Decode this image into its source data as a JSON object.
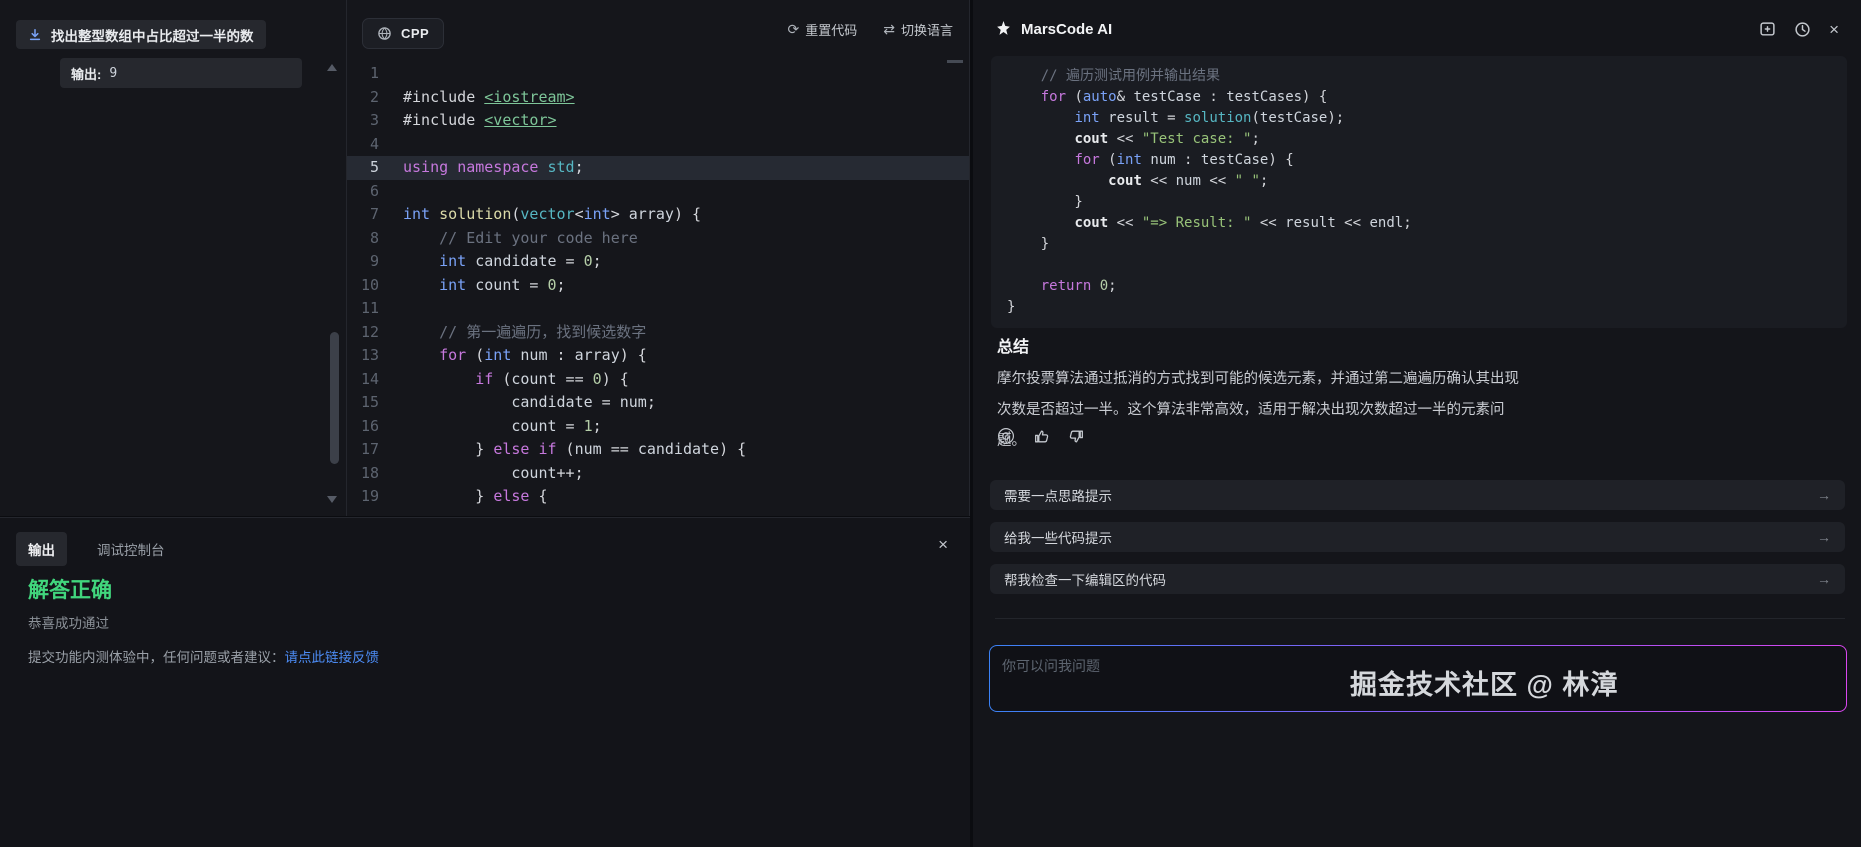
{
  "problem": {
    "title": "找出整型数组中占比超过一半的数",
    "sample": {
      "label": "输出:",
      "value": "9"
    }
  },
  "editor": {
    "language_label": "CPP",
    "actions": {
      "reset": "重置代码",
      "switch": "切换语言"
    },
    "highlight_line": 5,
    "lines": [
      {
        "n": 1,
        "tokens": []
      },
      {
        "n": 2,
        "tokens": [
          {
            "t": "#include ",
            "c": "pl"
          },
          {
            "t": "<iostream>",
            "c": "inc"
          }
        ]
      },
      {
        "n": 3,
        "tokens": [
          {
            "t": "#include ",
            "c": "pl"
          },
          {
            "t": "<vector>",
            "c": "inc"
          }
        ]
      },
      {
        "n": 4,
        "tokens": []
      },
      {
        "n": 5,
        "tokens": [
          {
            "t": "using",
            "c": "kw"
          },
          {
            "t": " ",
            "c": "pl"
          },
          {
            "t": "namespace",
            "c": "kw"
          },
          {
            "t": " ",
            "c": "pl"
          },
          {
            "t": "std",
            "c": "cls"
          },
          {
            "t": ";",
            "c": "pl"
          }
        ]
      },
      {
        "n": 6,
        "tokens": []
      },
      {
        "n": 7,
        "tokens": [
          {
            "t": "int",
            "c": "type"
          },
          {
            "t": " ",
            "c": "pl"
          },
          {
            "t": "solution",
            "c": "fn"
          },
          {
            "t": "(",
            "c": "pl"
          },
          {
            "t": "vector",
            "c": "cls"
          },
          {
            "t": "<",
            "c": "pl"
          },
          {
            "t": "int",
            "c": "type"
          },
          {
            "t": "> ",
            "c": "pl"
          },
          {
            "t": "array",
            "c": "var"
          },
          {
            "t": ") {",
            "c": "pl"
          }
        ]
      },
      {
        "n": 8,
        "tokens": [
          {
            "t": "    // Edit your code here",
            "c": "cm"
          }
        ]
      },
      {
        "n": 9,
        "tokens": [
          {
            "t": "    ",
            "c": "pl"
          },
          {
            "t": "int",
            "c": "type"
          },
          {
            "t": " ",
            "c": "pl"
          },
          {
            "t": "candidate",
            "c": "var"
          },
          {
            "t": " = ",
            "c": "pl"
          },
          {
            "t": "0",
            "c": "num"
          },
          {
            "t": ";",
            "c": "pl"
          }
        ]
      },
      {
        "n": 10,
        "tokens": [
          {
            "t": "    ",
            "c": "pl"
          },
          {
            "t": "int",
            "c": "type"
          },
          {
            "t": " ",
            "c": "pl"
          },
          {
            "t": "count",
            "c": "var"
          },
          {
            "t": " = ",
            "c": "pl"
          },
          {
            "t": "0",
            "c": "num"
          },
          {
            "t": ";",
            "c": "pl"
          }
        ]
      },
      {
        "n": 11,
        "tokens": []
      },
      {
        "n": 12,
        "tokens": [
          {
            "t": "    // 第一遍遍历，找到候选数字",
            "c": "cm"
          }
        ]
      },
      {
        "n": 13,
        "tokens": [
          {
            "t": "    ",
            "c": "pl"
          },
          {
            "t": "for",
            "c": "kw"
          },
          {
            "t": " (",
            "c": "pl"
          },
          {
            "t": "int",
            "c": "type"
          },
          {
            "t": " ",
            "c": "pl"
          },
          {
            "t": "num",
            "c": "var"
          },
          {
            "t": " : ",
            "c": "pl"
          },
          {
            "t": "array",
            "c": "var"
          },
          {
            "t": ") {",
            "c": "pl"
          }
        ]
      },
      {
        "n": 14,
        "tokens": [
          {
            "t": "        ",
            "c": "pl"
          },
          {
            "t": "if",
            "c": "kw"
          },
          {
            "t": " (",
            "c": "pl"
          },
          {
            "t": "count",
            "c": "var"
          },
          {
            "t": " == ",
            "c": "pl"
          },
          {
            "t": "0",
            "c": "num"
          },
          {
            "t": ") {",
            "c": "pl"
          }
        ]
      },
      {
        "n": 15,
        "tokens": [
          {
            "t": "            ",
            "c": "pl"
          },
          {
            "t": "candidate",
            "c": "var"
          },
          {
            "t": " = ",
            "c": "pl"
          },
          {
            "t": "num",
            "c": "var"
          },
          {
            "t": ";",
            "c": "pl"
          }
        ]
      },
      {
        "n": 16,
        "tokens": [
          {
            "t": "            ",
            "c": "pl"
          },
          {
            "t": "count",
            "c": "var"
          },
          {
            "t": " = ",
            "c": "pl"
          },
          {
            "t": "1",
            "c": "num"
          },
          {
            "t": ";",
            "c": "pl"
          }
        ]
      },
      {
        "n": 17,
        "tokens": [
          {
            "t": "        } ",
            "c": "pl"
          },
          {
            "t": "else",
            "c": "kw"
          },
          {
            "t": " ",
            "c": "pl"
          },
          {
            "t": "if",
            "c": "kw"
          },
          {
            "t": " (",
            "c": "pl"
          },
          {
            "t": "num",
            "c": "var"
          },
          {
            "t": " == ",
            "c": "pl"
          },
          {
            "t": "candidate",
            "c": "var"
          },
          {
            "t": ") {",
            "c": "pl"
          }
        ]
      },
      {
        "n": 18,
        "tokens": [
          {
            "t": "            ",
            "c": "pl"
          },
          {
            "t": "count",
            "c": "var"
          },
          {
            "t": "++;",
            "c": "pl"
          }
        ]
      },
      {
        "n": 19,
        "tokens": [
          {
            "t": "        } ",
            "c": "pl"
          },
          {
            "t": "else",
            "c": "kw"
          },
          {
            "t": " {",
            "c": "pl"
          }
        ]
      }
    ]
  },
  "console": {
    "tabs": [
      "输出",
      "调试控制台"
    ],
    "active_tab": "输出",
    "close_label": "×",
    "result_title": "解答正确",
    "result_subtitle": "恭喜成功通过",
    "feedback_prefix": "提交功能内测体验中，任何问题或者建议：",
    "feedback_link": "请点此链接反馈"
  },
  "assistant": {
    "title": "MarsCode AI",
    "close_label": "×",
    "code_lines": [
      [
        {
          "t": "    // 遍历测试用例并输出结果",
          "c": "cm"
        }
      ],
      [
        {
          "t": "    ",
          "c": "pl"
        },
        {
          "t": "for",
          "c": "kw"
        },
        {
          "t": " (",
          "c": "pl"
        },
        {
          "t": "auto",
          "c": "type"
        },
        {
          "t": "& ",
          "c": "pl"
        },
        {
          "t": "testCase",
          "c": "var"
        },
        {
          "t": " : ",
          "c": "pl"
        },
        {
          "t": "testCases",
          "c": "var"
        },
        {
          "t": ") {",
          "c": "pl"
        }
      ],
      [
        {
          "t": "        ",
          "c": "pl"
        },
        {
          "t": "int",
          "c": "type"
        },
        {
          "t": " ",
          "c": "pl"
        },
        {
          "t": "result",
          "c": "var"
        },
        {
          "t": " = ",
          "c": "pl"
        },
        {
          "t": "solution",
          "c": "cls"
        },
        {
          "t": "(",
          "c": "pl"
        },
        {
          "t": "testCase",
          "c": "var"
        },
        {
          "t": ");",
          "c": "pl"
        }
      ],
      [
        {
          "t": "        ",
          "c": "pl"
        },
        {
          "t": "cout",
          "c": "io"
        },
        {
          "t": " << ",
          "c": "pl"
        },
        {
          "t": "\"Test case: \"",
          "c": "str"
        },
        {
          "t": ";",
          "c": "pl"
        }
      ],
      [
        {
          "t": "        ",
          "c": "pl"
        },
        {
          "t": "for",
          "c": "kw"
        },
        {
          "t": " (",
          "c": "pl"
        },
        {
          "t": "int",
          "c": "type"
        },
        {
          "t": " ",
          "c": "pl"
        },
        {
          "t": "num",
          "c": "var"
        },
        {
          "t": " : ",
          "c": "pl"
        },
        {
          "t": "testCase",
          "c": "var"
        },
        {
          "t": ") {",
          "c": "pl"
        }
      ],
      [
        {
          "t": "            ",
          "c": "pl"
        },
        {
          "t": "cout",
          "c": "io"
        },
        {
          "t": " << ",
          "c": "pl"
        },
        {
          "t": "num",
          "c": "var"
        },
        {
          "t": " << ",
          "c": "pl"
        },
        {
          "t": "\" \"",
          "c": "str"
        },
        {
          "t": ";",
          "c": "pl"
        }
      ],
      [
        {
          "t": "        }",
          "c": "pl"
        }
      ],
      [
        {
          "t": "        ",
          "c": "pl"
        },
        {
          "t": "cout",
          "c": "io"
        },
        {
          "t": " << ",
          "c": "pl"
        },
        {
          "t": "\"=> Result: \"",
          "c": "str"
        },
        {
          "t": " << ",
          "c": "pl"
        },
        {
          "t": "result",
          "c": "var"
        },
        {
          "t": " << ",
          "c": "pl"
        },
        {
          "t": "endl",
          "c": "var"
        },
        {
          "t": ";",
          "c": "pl"
        }
      ],
      [
        {
          "t": "    }",
          "c": "pl"
        }
      ],
      [],
      [
        {
          "t": "    ",
          "c": "pl"
        },
        {
          "t": "return",
          "c": "kw"
        },
        {
          "t": " ",
          "c": "pl"
        },
        {
          "t": "0",
          "c": "num"
        },
        {
          "t": ";",
          "c": "pl"
        }
      ],
      [
        {
          "t": "}",
          "c": "pl"
        }
      ]
    ],
    "summary_heading": "总结",
    "summary_text": "摩尔投票算法通过抵消的方式找到可能的候选元素，并通过第二遍遍历确认其出现次数是否超过一半。这个算法非常高效，适用于解决出现次数超过一半的元素问题。",
    "suggestions": [
      "需要一点思路提示",
      "给我一些代码提示",
      "帮我检查一下编辑区的代码"
    ],
    "suggestion_arrow": "→",
    "input_placeholder": "你可以问我问题",
    "watermark": "掘金技术社区 @ 林漳"
  },
  "colors": {
    "success": "#41d67d",
    "link": "#4c8cf5",
    "line_highlight": "#262a33",
    "accent_gradient": [
      "#3b82f6",
      "#8b5cf6",
      "#d946ef"
    ]
  }
}
